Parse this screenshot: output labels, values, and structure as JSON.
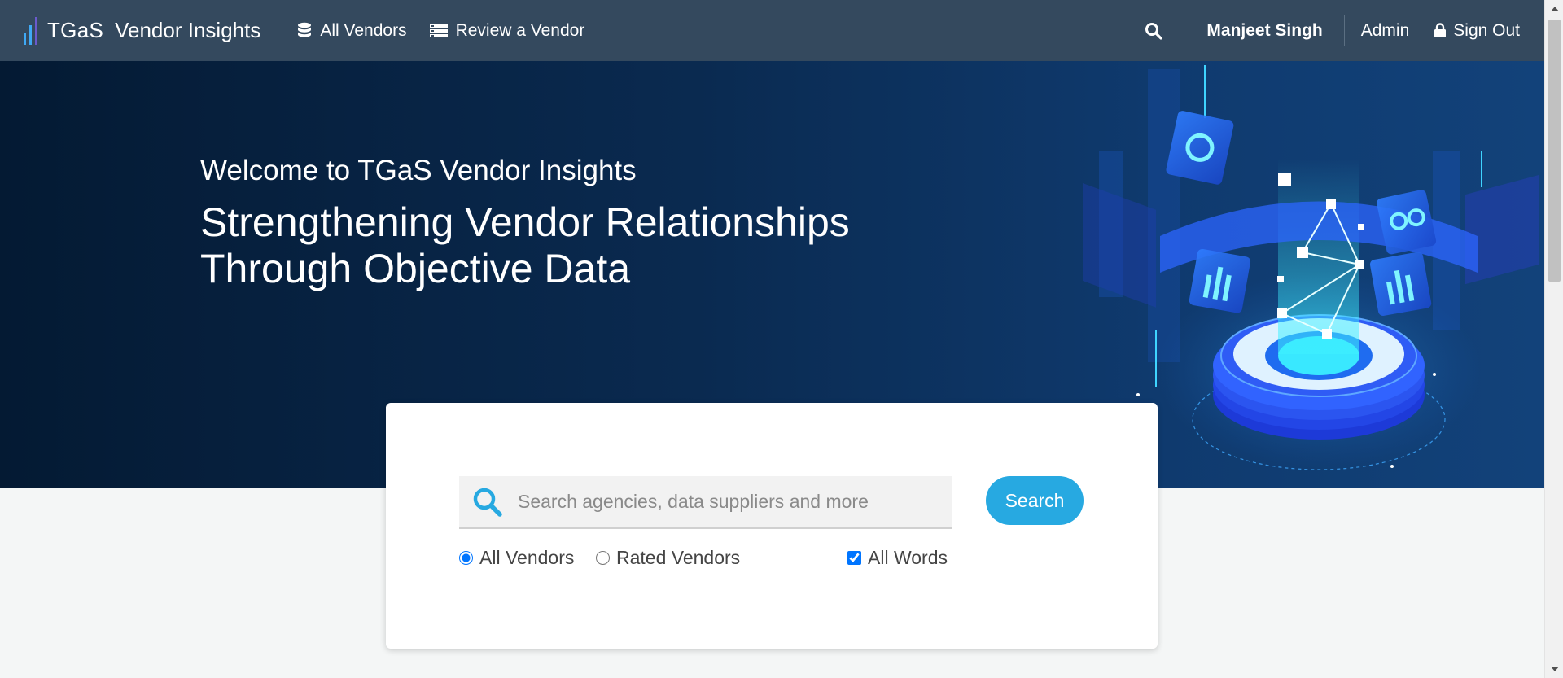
{
  "navbar": {
    "brand_name": "TGaS",
    "product_name": "Vendor Insights",
    "links": [
      {
        "label": "All Vendors",
        "icon": "database-icon"
      },
      {
        "label": "Review a Vendor",
        "icon": "list-icon"
      }
    ],
    "user_name": "Manjeet Singh",
    "admin_label": "Admin",
    "signout_label": "Sign Out"
  },
  "hero": {
    "welcome": "Welcome to TGaS Vendor Insights",
    "headline_line1": "Strengthening Vendor Relationships",
    "headline_line2": "Through Objective Data"
  },
  "search": {
    "placeholder": "Search agencies, data suppliers and more",
    "value": "",
    "button_label": "Search",
    "options": {
      "all_vendors_label": "All Vendors",
      "all_vendors_checked": true,
      "rated_vendors_label": "Rated Vendors",
      "rated_vendors_checked": false,
      "all_words_label": "All Words",
      "all_words_checked": true
    }
  },
  "colors": {
    "navbar_bg": "#34495e",
    "accent": "#27a9e1",
    "hero_bg": "#0a2a50"
  }
}
